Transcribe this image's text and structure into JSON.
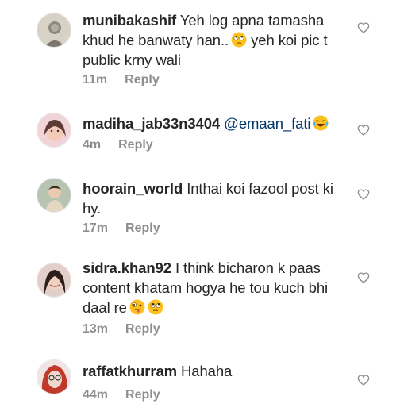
{
  "comments": [
    {
      "username": "munibakashif",
      "text_1": "Yeh log apna tamasha khud he banwaty han..",
      "emoji_1": "face-with-rolling-eyes",
      "text_2": "yeh koi pic t public krny wali",
      "time": "11m",
      "reply_label": "Reply",
      "avatar_color": "#c9c2b6"
    },
    {
      "username": "madiha_jab33n3404",
      "mention": "@emaan_fati",
      "emoji_1": "face-with-tears-of-joy",
      "time": "4m",
      "reply_label": "Reply",
      "avatar_color": "#e9c2c6"
    },
    {
      "username": "hoorain_world",
      "text_1": "Inthai koi fazool post ki hy.",
      "time": "17m",
      "reply_label": "Reply",
      "avatar_color": "#a9b9a6"
    },
    {
      "username": "sidra.khan92",
      "text_1": "I think bicharon k paas content khatam hogya he tou kuch bhi daal re",
      "emoji_1": "zany-face",
      "emoji_2": "face-with-rolling-eyes",
      "time": "13m",
      "reply_label": "Reply",
      "avatar_color": "#d7b9b5"
    },
    {
      "username": "raffatkhurram",
      "text_1": "Hahaha",
      "time": "44m",
      "reply_label": "Reply",
      "avatar_color": "#c0392b"
    }
  ],
  "colors": {
    "text": "#262626",
    "meta": "#8e8e8e",
    "mention": "#00376b",
    "heart_outline": "#8e8e8e"
  },
  "icons": [
    "heart-outline-icon",
    "face-with-rolling-eyes",
    "face-with-tears-of-joy",
    "zany-face"
  ]
}
